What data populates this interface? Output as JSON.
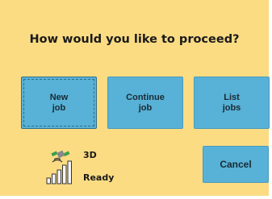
{
  "dialog": {
    "question": "How would you like to proceed?"
  },
  "buttons": {
    "new_job": "New\njob",
    "continue_job": "Continue\njob",
    "list_jobs": "List\njobs",
    "cancel": "Cancel"
  },
  "status": {
    "mode": "3D",
    "state": "Ready",
    "icon": "satellite-signal-icon"
  },
  "colors": {
    "background": "#fbdc83",
    "button": "#58b1d6",
    "text": "#1a1a1a"
  }
}
